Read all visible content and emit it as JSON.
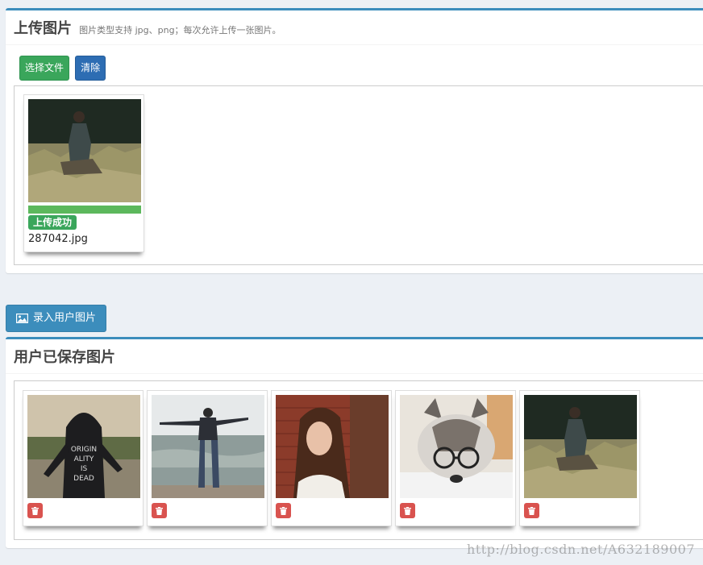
{
  "upload": {
    "title": "上传图片",
    "subtitle": "图片类型支持 jpg、png；每次允许上传一张图片。",
    "choose_label": "选择文件",
    "clear_label": "清除",
    "file": {
      "status": "上传成功",
      "name": "287042.jpg",
      "progress": 1.0
    }
  },
  "entry_button_label": "录入用户图片",
  "saved": {
    "title": "用户已保存图片"
  },
  "watermark": "http://blog.csdn.net/A632189007",
  "colors": {
    "primary": "#3c8dbc",
    "success": "#3aa65b",
    "danger": "#d9534f",
    "background": "#ecf0f5"
  }
}
